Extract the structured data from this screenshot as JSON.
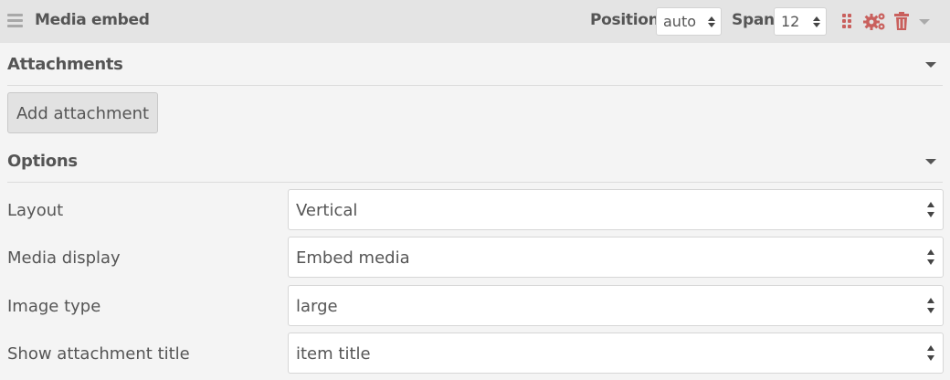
{
  "header": {
    "title": "Media embed",
    "position_label": "Position",
    "position_value": "auto",
    "span_label": "Span",
    "span_value": "12",
    "icons": [
      "drag-icon",
      "settings-icon",
      "trash-icon",
      "caret-down-icon"
    ],
    "icon_color": "#c9605d"
  },
  "attachments": {
    "title": "Attachments",
    "add_button": "Add attachment"
  },
  "options": {
    "title": "Options",
    "rows": [
      {
        "label": "Layout",
        "value": "Vertical"
      },
      {
        "label": "Media display",
        "value": "Embed media"
      },
      {
        "label": "Image type",
        "value": "large"
      },
      {
        "label": "Show attachment title",
        "value": "item title"
      }
    ]
  }
}
